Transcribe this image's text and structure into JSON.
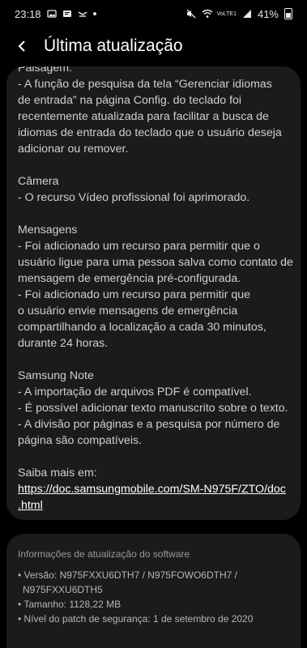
{
  "status_bar": {
    "time": "23:18",
    "battery": "41%",
    "network_label": "VoLTE1",
    "left_icons": [
      "image-icon",
      "vpn-icon",
      "mail-icon",
      "dot-icon"
    ],
    "right_icons": [
      "mute-icon",
      "wifi-icon",
      "signal-icon",
      "battery-icon"
    ]
  },
  "header": {
    "title": "Última atualização"
  },
  "content": {
    "lines": [
      "Paisagem.",
      " - A função de pesquisa da tela “Gerenciar idiomas",
      "de entrada” na página Config. do teclado foi",
      "recentemente atualizada para facilitar a busca de",
      "idiomas de entrada do teclado que o usuário deseja",
      "adicionar ou remover.",
      "",
      "Câmera",
      " - O recurso Vídeo profissional foi aprimorado.",
      "",
      "Mensagens",
      " - Foi adicionado um recurso para permitir que o",
      "usuário ligue para uma pessoa salva como contato de",
      "mensagem de emergência pré-configurada.",
      " - Foi adicionado um recurso para permitir que",
      "o usuário envie mensagens de emergência",
      "compartilhando a localização a cada 30 minutos,",
      "durante 24 horas.",
      "",
      "Samsung Note",
      " - A importação de arquivos PDF é compatível.",
      " - É possível adicionar texto manuscrito sobre o texto.",
      " - A divisão por páginas e a pesquisa por número de",
      "página são compatíveis.",
      "",
      "Saiba mais em:"
    ],
    "link_line1": "https://doc.samsungmobile.com/SM-N975F/ZTO/doc",
    "link_line2": ".html"
  },
  "software_info": {
    "title": "Informações de atualização do software",
    "items": [
      "• Versão: N975FXXU6DTH7 / N975FOWO6DTH7 /",
      "  N975FXXU6DTH5",
      "• Tamanho: 1128,22 MB",
      "• Nível do patch de segurança: 1 de setembro de 2020"
    ]
  }
}
